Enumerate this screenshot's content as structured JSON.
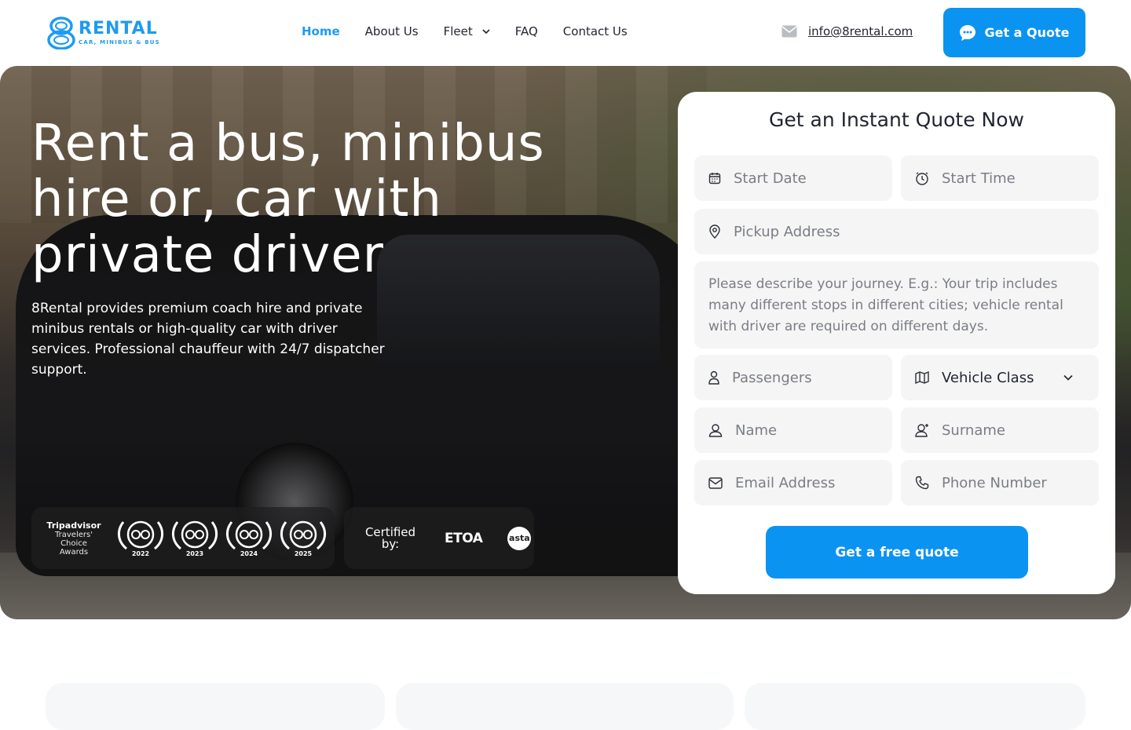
{
  "header": {
    "logo_title": "RENTAL",
    "logo_subtitle": "CAR, MINIBUS & BUS",
    "nav": {
      "home": "Home",
      "about": "About Us",
      "fleet": "Fleet",
      "faq": "FAQ",
      "contact": "Contact Us"
    },
    "email": "info@8rental.com",
    "cta_label": "Get a Quote"
  },
  "hero": {
    "title": "Rent a bus, minibus hire or, car with private driver",
    "description": "8Rental provides premium coach hire and private minibus rentals or high-quality car with driver services. Professional chauffeur with 24/7 dispatcher support.",
    "awards": {
      "brand": "Tripadvisor",
      "label": "Travelers' Choice Awards",
      "years": [
        "2022",
        "2023",
        "2024",
        "2025"
      ]
    },
    "certified": {
      "label": "Certified by:",
      "etoa": "ETOA",
      "asta": "asta"
    }
  },
  "quote_form": {
    "title": "Get an Instant Quote Now",
    "start_date_placeholder": "Start Date",
    "start_time_placeholder": "Start Time",
    "pickup_placeholder": "Pickup Address",
    "journey_placeholder": "Please describe your journey. E.g.: Your trip includes many different stops in different cities; vehicle rental with driver are required on different days.",
    "passengers_placeholder": "Passengers",
    "vehicle_class_value": "Vehicle Class",
    "name_placeholder": "Name",
    "surname_placeholder": "Surname",
    "email_placeholder": "Email Address",
    "phone_placeholder": "Phone Number",
    "submit_label": "Get a free quote"
  },
  "colors": {
    "accent": "#0b93f2",
    "logo": "#1d9bf0"
  }
}
